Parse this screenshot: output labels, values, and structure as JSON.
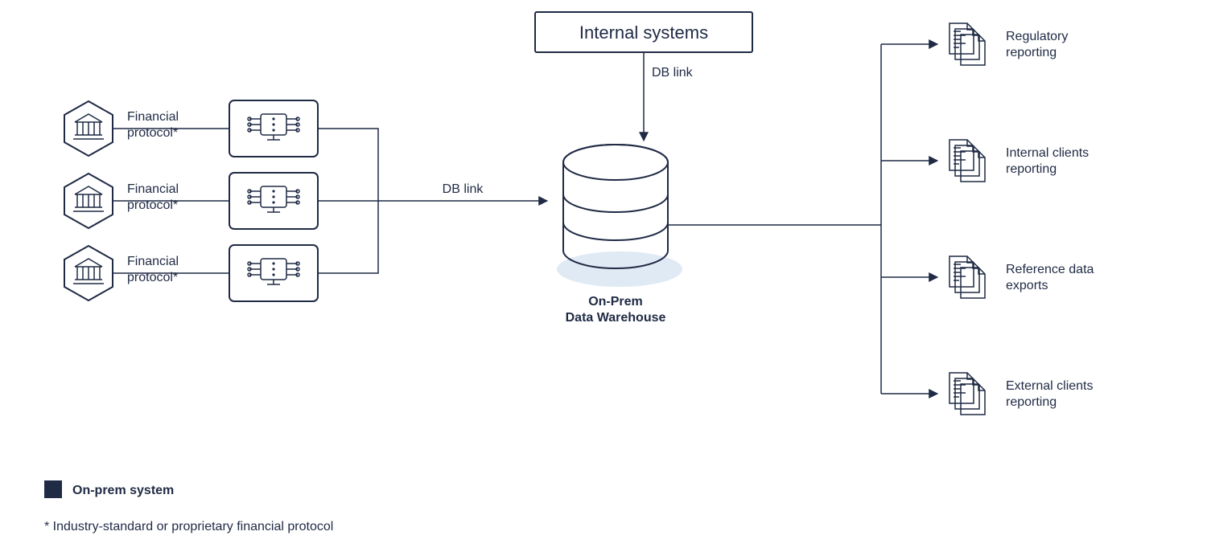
{
  "top_box": {
    "label": "Internal systems"
  },
  "left_sources": [
    {
      "edge_label": "Financial\nprotocol*"
    },
    {
      "edge_label": "Financial\nprotocol*"
    },
    {
      "edge_label": "Financial\nprotocol*"
    }
  ],
  "db_link_left": "DB link",
  "db_link_top": "DB link",
  "center": {
    "title_line1": "On-Prem",
    "title_line2": "Data Warehouse"
  },
  "outputs": [
    {
      "label_line1": "Regulatory",
      "label_line2": "reporting"
    },
    {
      "label_line1": "Internal clients",
      "label_line2": "reporting"
    },
    {
      "label_line1": "Reference data",
      "label_line2": "exports"
    },
    {
      "label_line1": "External clients",
      "label_line2": "reporting"
    }
  ],
  "legend": {
    "item1": "On-prem system"
  },
  "footnote": "* Industry-standard or proprietary financial protocol"
}
